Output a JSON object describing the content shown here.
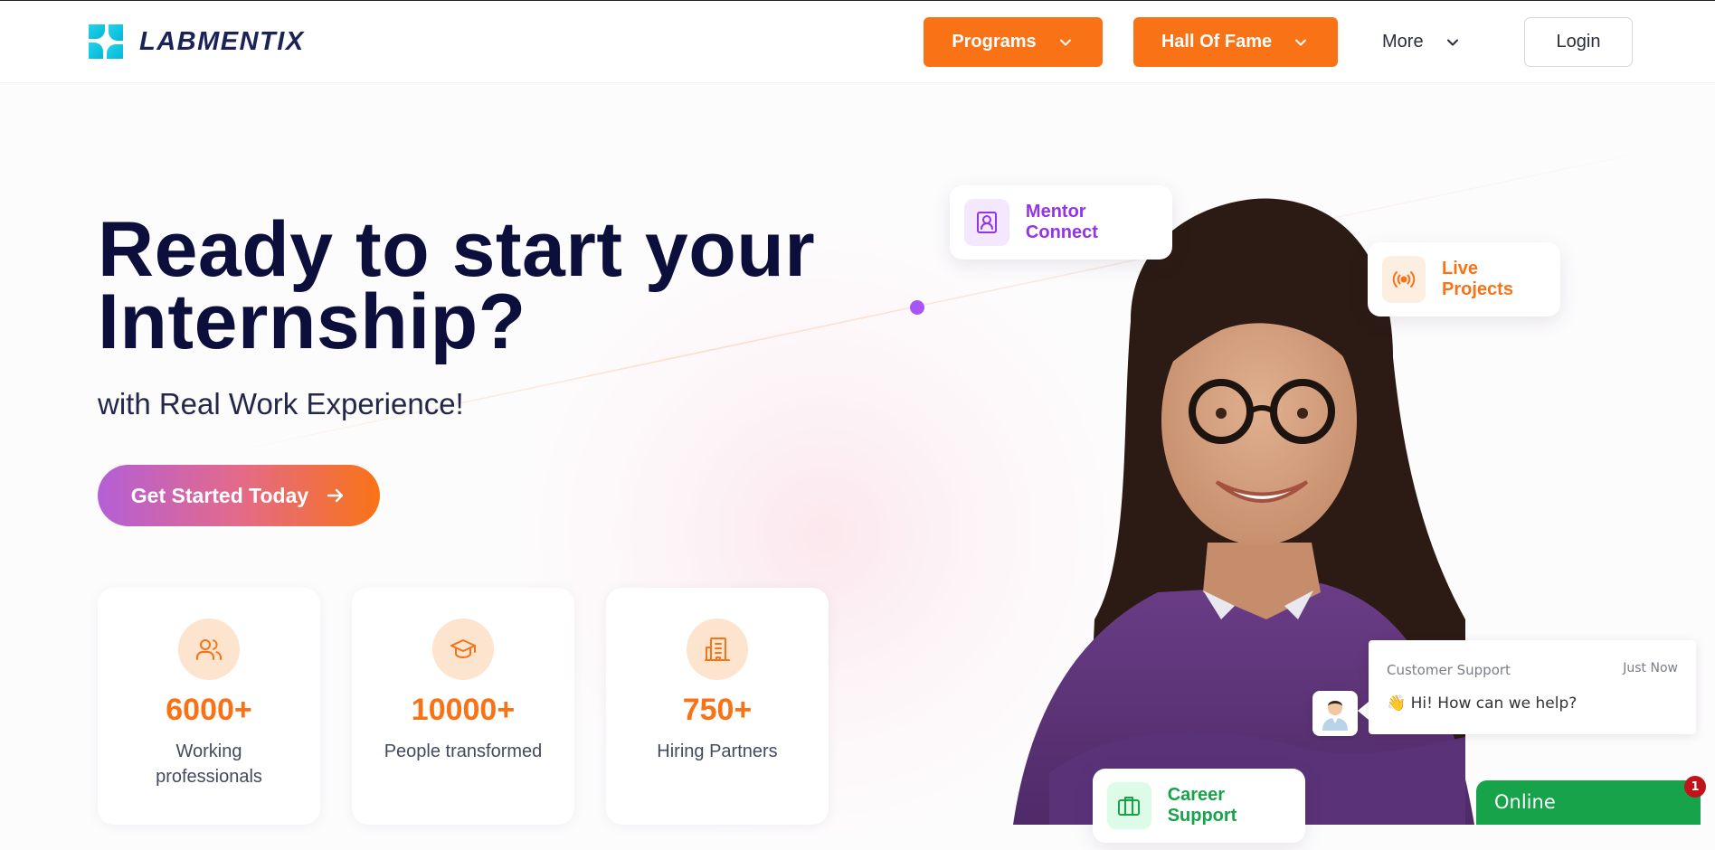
{
  "header": {
    "brand": "LABMENTIX",
    "nav": {
      "programs": "Programs",
      "hall_of_fame": "Hall Of Fame",
      "more": "More",
      "login": "Login"
    }
  },
  "hero": {
    "title": "Ready to start your Internship?",
    "subtitle": "with Real Work Experience!",
    "cta": "Get Started Today"
  },
  "stats": [
    {
      "value": "6000+",
      "label": "Working professionals",
      "icon": "users-icon"
    },
    {
      "value": "10000+",
      "label": "People transformed",
      "icon": "graduation-cap-icon"
    },
    {
      "value": "750+",
      "label": "Hiring Partners",
      "icon": "building-icon"
    }
  ],
  "features": {
    "mentor": "Mentor Connect",
    "live": "Live Projects",
    "career": "Career Support"
  },
  "chat": {
    "title": "Customer Support",
    "time": "Just Now",
    "message": "👋 Hi! How can we help?",
    "online": "Online",
    "badge": "1"
  },
  "colors": {
    "accent": "#f97316",
    "purple": "#a855f7",
    "navy": "#0c0f3c",
    "green": "#16a34a"
  }
}
